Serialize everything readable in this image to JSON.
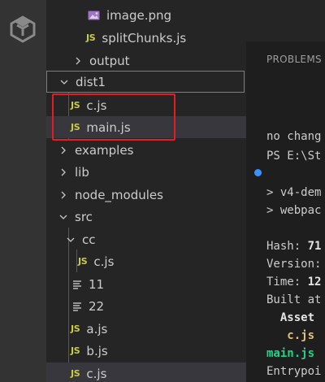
{
  "explorer": {
    "items": [
      {
        "label": "image.png",
        "icon": "image-icon"
      },
      {
        "label": "splitChunks.js",
        "icon": "js-icon"
      },
      {
        "label": "output",
        "icon": "chevron-right-icon"
      },
      {
        "label": "dist1",
        "icon": "chevron-down-icon"
      },
      {
        "label": "c.js",
        "icon": "js-icon"
      },
      {
        "label": "main.js",
        "icon": "js-icon"
      },
      {
        "label": "examples",
        "icon": "chevron-right-icon"
      },
      {
        "label": "lib",
        "icon": "chevron-right-icon"
      },
      {
        "label": "node_modules",
        "icon": "chevron-right-icon"
      },
      {
        "label": "src",
        "icon": "chevron-down-icon"
      },
      {
        "label": "cc",
        "icon": "chevron-down-icon"
      },
      {
        "label": "c.js",
        "icon": "js-icon"
      },
      {
        "label": "11",
        "icon": "text-file-icon"
      },
      {
        "label": "22",
        "icon": "text-file-icon"
      },
      {
        "label": "a.js",
        "icon": "js-icon"
      },
      {
        "label": "b.js",
        "icon": "js-icon"
      },
      {
        "label": "c.js",
        "icon": "js-icon"
      }
    ],
    "js_badge": "JS"
  },
  "panel": {
    "tab_label": "PROBLEMS",
    "terminal_lines": [
      "no chang",
      "PS E:\\St",
      "> v4-dem",
      "> webpac",
      "Hash: ",
      "71",
      "Version:",
      "Time: ",
      "12",
      "Built at",
      "  Asset",
      "   c.js",
      "main.js",
      "Entrypoi"
    ]
  },
  "colors": {
    "js_icon": "#cbcb41",
    "annotation_red": "#e51c23",
    "selected_row": "#37373d",
    "terminal_dot": "#3794ff",
    "terminal_green": "#23d18b"
  }
}
